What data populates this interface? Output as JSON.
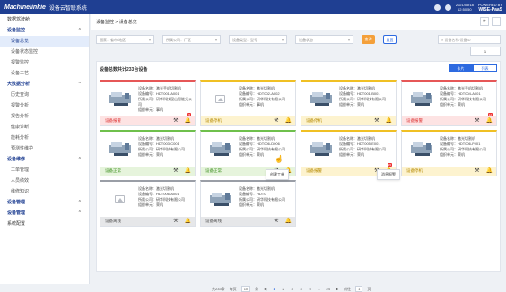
{
  "header": {
    "logo": "Machinelinkie",
    "title": "设备云智联系统",
    "date": "2021/09/18",
    "time": "12:50:50",
    "powered_by": "POWERED BY",
    "brand": "WISE-PaaS"
  },
  "sidebar": {
    "items": [
      {
        "label": "数据驾驶舱",
        "type": "item"
      },
      {
        "label": "设备监控",
        "type": "group"
      },
      {
        "label": "设备总览",
        "type": "sub-active"
      },
      {
        "label": "设备状态监控",
        "type": "sub"
      },
      {
        "label": "报警监控",
        "type": "sub"
      },
      {
        "label": "设备工艺",
        "type": "sub"
      },
      {
        "label": "大数据分析",
        "type": "group"
      },
      {
        "label": "历史查询",
        "type": "sub"
      },
      {
        "label": "报警分析",
        "type": "sub"
      },
      {
        "label": "报告分析",
        "type": "sub"
      },
      {
        "label": "健康诊断",
        "type": "sub"
      },
      {
        "label": "能耗分析",
        "type": "sub"
      },
      {
        "label": "预测性维护",
        "type": "sub"
      },
      {
        "label": "设备维修",
        "type": "group"
      },
      {
        "label": "工单管理",
        "type": "sub"
      },
      {
        "label": "人员绩效",
        "type": "sub"
      },
      {
        "label": "维修知识",
        "type": "sub"
      },
      {
        "label": "设备管理",
        "type": "group"
      },
      {
        "label": "设备管理",
        "type": "group"
      },
      {
        "label": "系统配置",
        "type": "item"
      }
    ]
  },
  "breadcrumb": {
    "parent": "设备监控",
    "sep": ">",
    "current": "设备总览"
  },
  "filters": {
    "f1": "国家：省市/地区",
    "f2": "所属公司：厂区",
    "f3": "设备类型：型号",
    "f4": "设备状态",
    "query": "查询",
    "reset": "重置",
    "search_placeholder": "设备名称/设备ID"
  },
  "pager_small": "1",
  "panel": {
    "title": "设备总数共计233台设备",
    "view_card": "卡片",
    "view_list": "列表"
  },
  "card_labels": {
    "name": "设备名称：",
    "id": "设备编号：",
    "company": "所属公司：",
    "site": "组织单元："
  },
  "cards": [
    {
      "name": "激光手机切割机",
      "id": "HDT001-A001",
      "company": "研华科技昆山智能分公司",
      "site": "事机",
      "status": "设备报警",
      "color": "red",
      "badge": "15",
      "img": "machine"
    },
    {
      "name": "激光切割机",
      "id": "HDT002-A002",
      "company": "研华科技有限公司",
      "site": "事机",
      "status": "设备停机",
      "color": "yellow",
      "badge": "",
      "img": "placeholder"
    },
    {
      "name": "激光切割机",
      "id": "HDT001-B001",
      "company": "研华科技有限公司",
      "site": "荣机",
      "status": "设备停机",
      "color": "yellow",
      "badge": "",
      "img": "machine"
    },
    {
      "name": "激光手机切割机",
      "id": "HDT004-A001",
      "company": "研华科技有限公司",
      "site": "荣机",
      "status": "设备报警",
      "color": "red",
      "badge": "12",
      "img": "machine"
    },
    {
      "name": "激光切割机",
      "id": "HDT003-C001",
      "company": "研华科技有限公司",
      "site": "荣机",
      "status": "设备正常",
      "color": "green",
      "badge": "",
      "img": "machine"
    },
    {
      "name": "激光切割机",
      "id": "HDT006-D006",
      "company": "研华科技有限公司",
      "site": "荣机",
      "status": "设备正常",
      "color": "green",
      "badge": "",
      "img": "machine"
    },
    {
      "name": "激光切割机",
      "id": "HDT005-E001",
      "company": "研华科技有限公司",
      "site": "荣机",
      "status": "设备报警",
      "color": "yellow",
      "badge": "25",
      "img": "machine"
    },
    {
      "name": "激光切割机",
      "id": "HDT006-F001",
      "company": "研华科技有限公司",
      "site": "荣机",
      "status": "设备停机",
      "color": "yellow",
      "badge": "",
      "img": "machine"
    },
    {
      "name": "激光切割机",
      "id": "HDT006-A001",
      "company": "研华科技有限公司",
      "site": "荣机",
      "status": "设备离线",
      "color": "gray",
      "badge": "",
      "img": "placeholder"
    },
    {
      "name": "激光切割机",
      "id": "HDT0",
      "company": "研华科技有限公司",
      "site": "荣机",
      "status": "设备离线",
      "color": "gray",
      "badge": "",
      "img": "machine"
    }
  ],
  "tooltips": {
    "work": "创建工单",
    "alarm": "消息报警"
  },
  "pagination": {
    "total": "共233条",
    "per_page_label": "每页",
    "per_page": "10",
    "unit": "条",
    "prev": "◀",
    "pages": [
      "1",
      "2",
      "3",
      "4",
      "5",
      "...",
      "24"
    ],
    "next": "▶",
    "goto_label": "前往",
    "goto_value": "1",
    "goto_unit": "页"
  }
}
